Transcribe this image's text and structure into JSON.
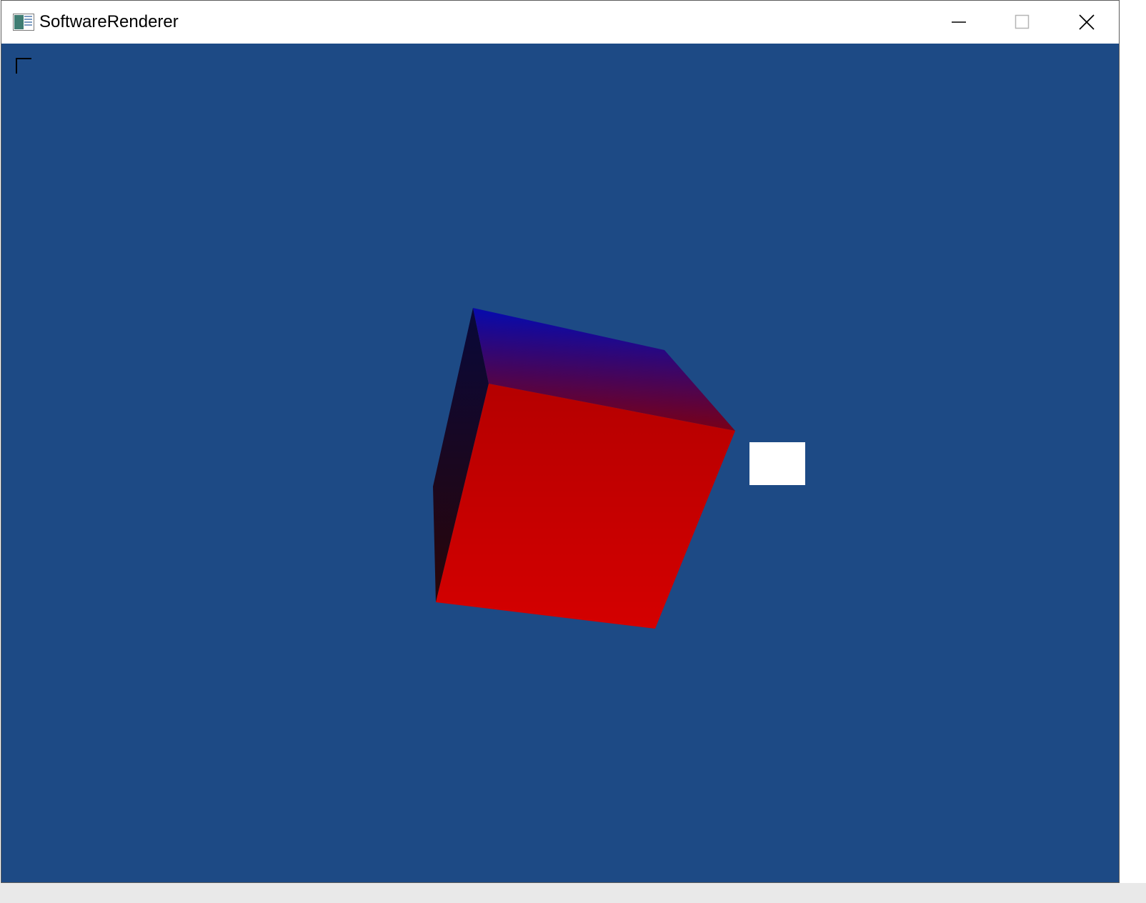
{
  "window": {
    "title": "SoftwareRenderer"
  },
  "icons": {
    "app": "app-window-icon",
    "minimize": "minimize-icon",
    "maximize": "maximize-icon",
    "close": "close-icon"
  },
  "scene": {
    "background_color": "#1d4a85",
    "cube_front_color": "#c00000",
    "cube_top_colors": [
      "#0a0aa8",
      "#7a0016"
    ],
    "cube_side_colors": [
      "#08083a",
      "#2a0608"
    ],
    "light_marker_color": "#ffffff"
  }
}
